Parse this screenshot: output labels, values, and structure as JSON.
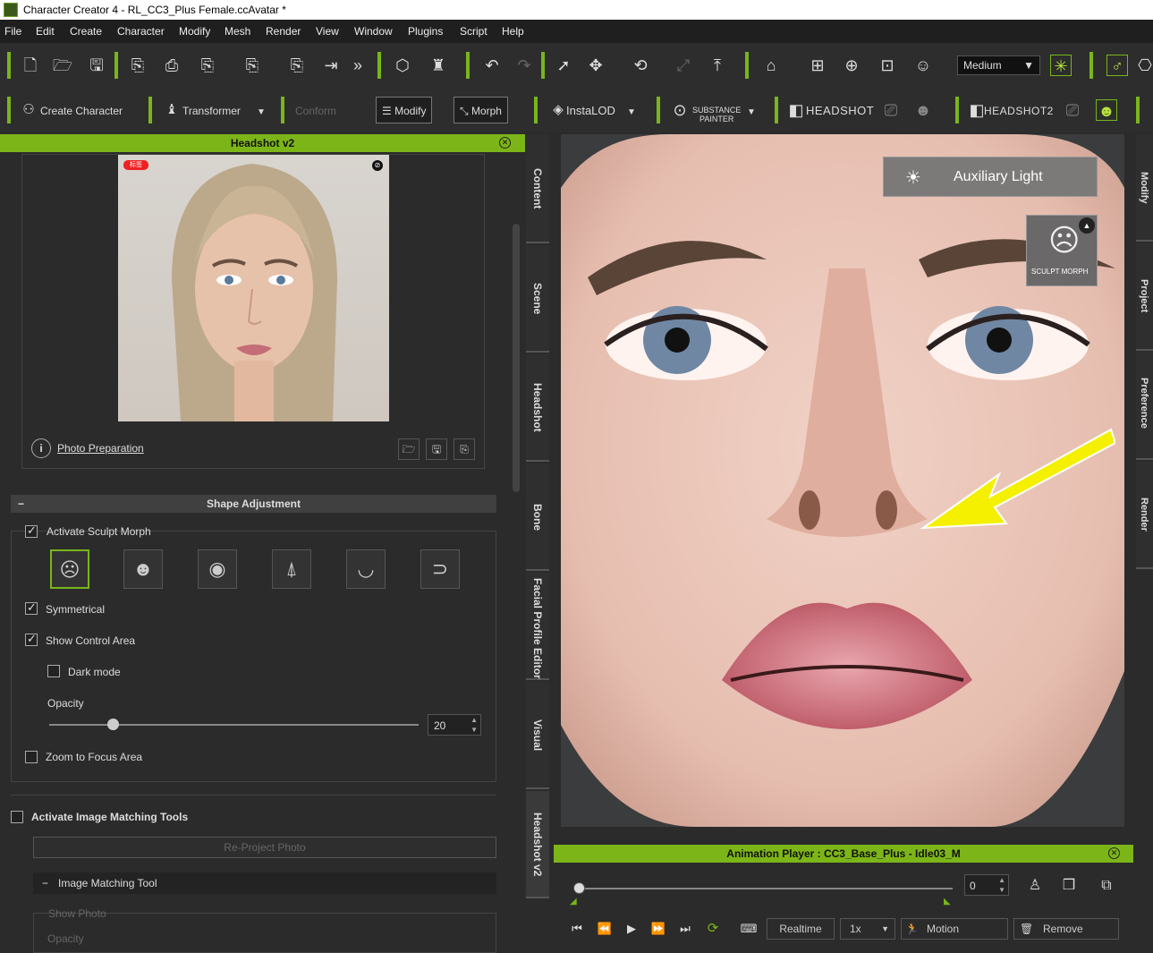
{
  "window": {
    "title": "Character Creator 4 - RL_CC3_Plus Female.ccAvatar *"
  },
  "menu": [
    "File",
    "Edit",
    "Create",
    "Character",
    "Modify",
    "Mesh",
    "Render",
    "View",
    "Window",
    "Plugins",
    "Script",
    "Help"
  ],
  "toolbar1": {
    "quality": "Medium"
  },
  "toolbar2": {
    "create_character": "Create Character",
    "transformer": "Transformer",
    "conform": "Conform",
    "modify": "Modify",
    "morph": "Morph",
    "instalod": "InstaLOD",
    "substance_line1": "SUBSTANCE",
    "substance_line2": "PAINTER",
    "headshot": "HEADSHOT",
    "headshot2": "HEADSHOT2"
  },
  "panel": {
    "title": "Headshot v2",
    "photo_badge": "标签",
    "photo_preparation": "Photo Preparation",
    "shape_adjustment": "Shape Adjustment",
    "activate_sculpt_morph": "Activate Sculpt Morph",
    "symmetrical": "Symmetrical",
    "show_control_area": "Show Control Area",
    "dark_mode": "Dark mode",
    "opacity_label": "Opacity",
    "opacity_value": "20",
    "zoom_to_focus": "Zoom to Focus Area",
    "activate_image_matching": "Activate Image Matching Tools",
    "reproject_photo": "Re-Project Photo",
    "image_matching_tool": "Image Matching Tool",
    "show_photo": "Show Photo",
    "opacity2_label": "Opacity",
    "checks": {
      "activate_sculpt_morph": true,
      "symmetrical": true,
      "show_control_area": true,
      "dark_mode": false,
      "zoom_to_focus": false,
      "activate_image_matching": false
    },
    "opacity_fraction": 0.17
  },
  "side_tabs": [
    "Content",
    "Scene",
    "Headshot",
    "Bone",
    "Facial Profile Editor",
    "Visual",
    "Headshot v2"
  ],
  "right_tabs": [
    "Modify",
    "Project",
    "Preference",
    "Render"
  ],
  "viewport": {
    "auxiliary_light": "Auxiliary Light",
    "sculpt_morph": "SCULPT MORPH"
  },
  "anim_player": {
    "title": "Animation Player : CC3_Base_Plus - Idle03_M",
    "frame": "0",
    "realtime": "Realtime",
    "speed": "1x",
    "motion": "Motion",
    "remove": "Remove"
  },
  "colors": {
    "accent": "#7cb518",
    "arrow": "#f5f000"
  }
}
